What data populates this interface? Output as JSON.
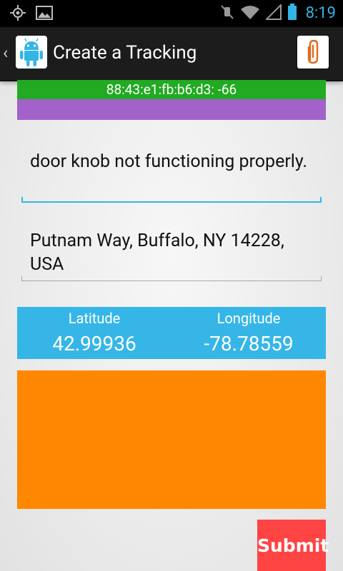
{
  "status_bar": {
    "time": "8:19",
    "icons": [
      "gps-icon",
      "image-icon",
      "mute-icon",
      "wifi-icon",
      "signal-icon",
      "battery-icon"
    ]
  },
  "action_bar": {
    "title": "Create a Tracking",
    "icons": [
      "up-chevron-icon",
      "android-app-icon",
      "attach-icon"
    ]
  },
  "beacon": {
    "text": "88:43:e1:fb:b6:d3: -66",
    "color": "#22aa22",
    "secondary_color": "#a262c9"
  },
  "form": {
    "description": "door knob not functioning properly.",
    "address": "Putnam Way, Buffalo, NY 14228, USA"
  },
  "location": {
    "latitude_label": "Latitude",
    "longitude_label": "Longitude",
    "latitude": "42.99936",
    "longitude": "-78.78559",
    "color": "#35b6e7"
  },
  "image_placeholder": {
    "color": "#ff8800"
  },
  "submit_label": "Submit",
  "colors": {
    "accent": "#33b5e5",
    "submit": "#ff4444"
  }
}
